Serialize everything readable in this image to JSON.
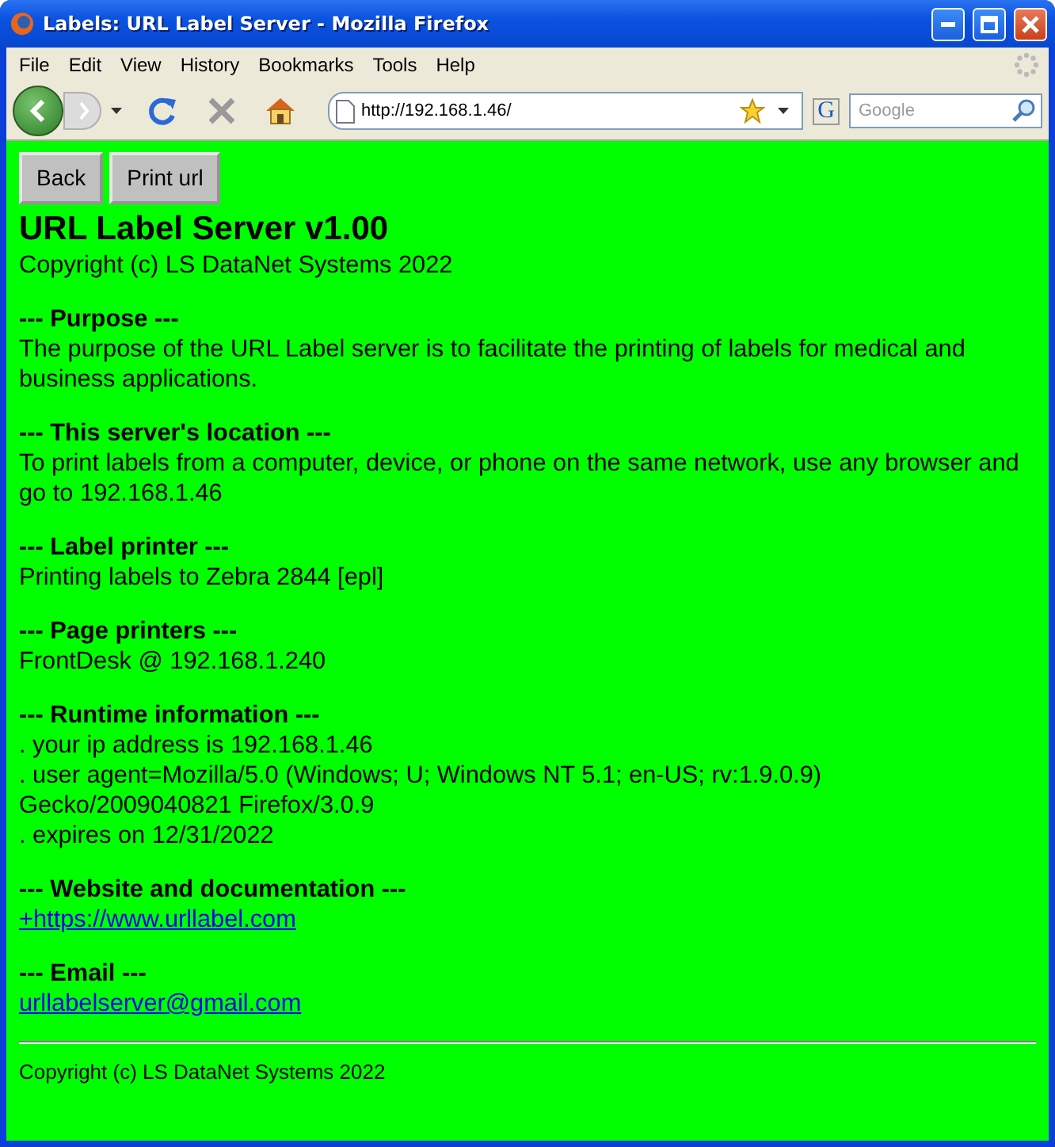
{
  "window": {
    "title": "Labels: URL Label Server - Mozilla Firefox"
  },
  "menu": [
    "File",
    "Edit",
    "View",
    "History",
    "Bookmarks",
    "Tools",
    "Help"
  ],
  "address": {
    "value": "http://192.168.1.46/"
  },
  "search": {
    "placeholder": "Google",
    "engine": "G"
  },
  "buttons": [
    "Back",
    "Print url"
  ],
  "heading": "URL Label Server v1.00",
  "copyright": "Copyright (c) LS DataNet Systems 2022",
  "sections": [
    {
      "heading": "--- Purpose ---",
      "lines": [
        {
          "kind": "text",
          "text": "The purpose of the URL Label server is to facilitate the printing of labels for medical and business applications."
        }
      ]
    },
    {
      "heading": "--- This server's location ---",
      "lines": [
        {
          "kind": "text",
          "text": "To print labels from a computer, device, or phone on the same network, use any browser and go to 192.168.1.46"
        }
      ]
    },
    {
      "heading": "--- Label printer ---",
      "lines": [
        {
          "kind": "text",
          "text": "Printing labels to Zebra 2844 [epl]"
        }
      ]
    },
    {
      "heading": "--- Page printers ---",
      "lines": [
        {
          "kind": "text",
          "text": "FrontDesk @ 192.168.1.240"
        }
      ]
    },
    {
      "heading": "--- Runtime information ---",
      "lines": [
        {
          "kind": "text",
          "text": ". your ip address is 192.168.1.46"
        },
        {
          "kind": "text",
          "text": ". user agent=Mozilla/5.0 (Windows; U; Windows NT 5.1; en-US; rv:1.9.0.9)"
        },
        {
          "kind": "text",
          "text": "Gecko/2009040821 Firefox/3.0.9"
        },
        {
          "kind": "text",
          "text": ". expires on 12/31/2022"
        }
      ]
    },
    {
      "heading": "--- Website and documentation ---",
      "lines": [
        {
          "kind": "link",
          "text": "+https://www.urllabel.com"
        }
      ]
    },
    {
      "heading": "--- Email ---",
      "lines": [
        {
          "kind": "link",
          "text": "urllabelserver@gmail.com"
        }
      ]
    }
  ],
  "footer": "Copyright (c) LS DataNet Systems 2022"
}
